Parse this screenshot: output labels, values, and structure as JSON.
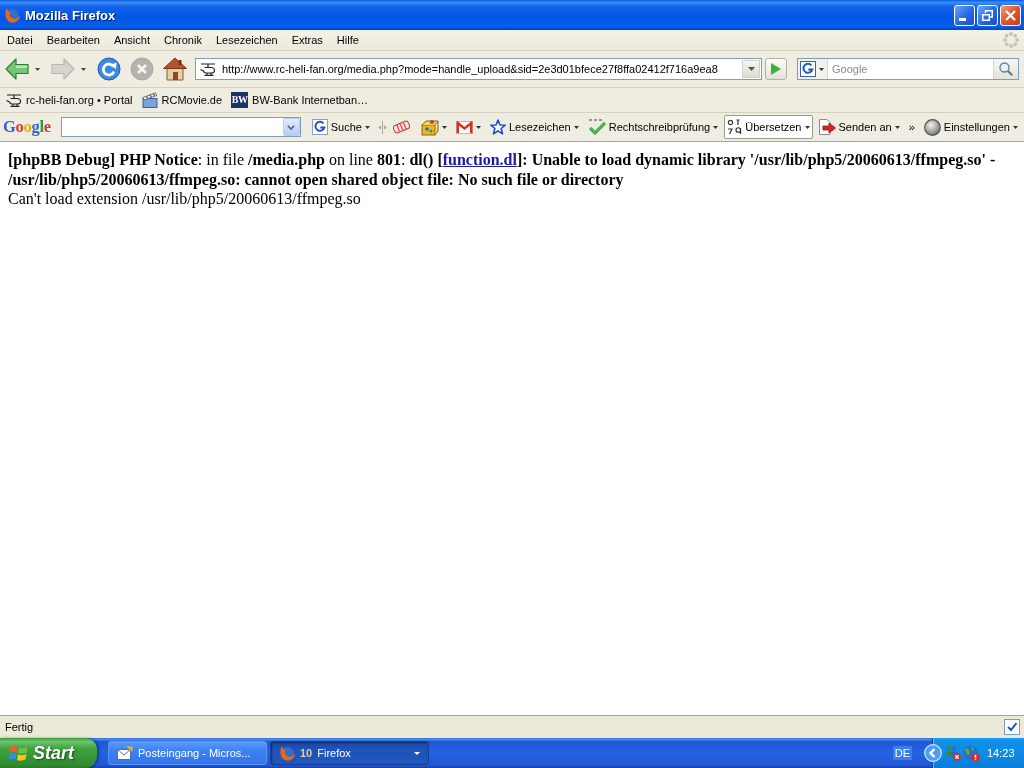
{
  "window": {
    "title": "Mozilla Firefox"
  },
  "menu_bar": [
    "Datei",
    "Bearbeiten",
    "Ansicht",
    "Chronik",
    "Lesezeichen",
    "Extras",
    "Hilfe"
  ],
  "navigation_toolbar": {
    "buttons": [
      {
        "kind": "back",
        "disabled": false,
        "menu": true
      },
      {
        "kind": "forward",
        "disabled": true,
        "menu": true
      },
      {
        "kind": "reload",
        "disabled": false,
        "menu": false
      },
      {
        "kind": "stop",
        "disabled": true,
        "menu": false
      },
      {
        "kind": "home",
        "disabled": false,
        "menu": false
      }
    ],
    "address": "http://www.rc-heli-fan.org/media.php?mode=handle_upload&sid=2e3d01bfece27f8ffa02412f716a9ea8",
    "search": {
      "placeholder": "Google"
    }
  },
  "bookmarks_toolbar": [
    {
      "kind": "helicopter",
      "label": "rc-heli-fan.org • Portal"
    },
    {
      "kind": "clapperboard",
      "label": "RCMovie.de"
    },
    {
      "kind": "logo",
      "logo": "BW",
      "label": "BW-Bank Internetban…"
    }
  ],
  "google_toolbar": {
    "logo": "Google",
    "items": [
      {
        "kind": "search",
        "label": "Suche",
        "menu": true,
        "highlighted": false
      },
      {
        "kind": "bandage",
        "menu": false,
        "highlighted": false
      },
      {
        "kind": "cube",
        "menu": true,
        "highlighted": false
      },
      {
        "kind": "mail",
        "menu": true,
        "highlighted": false
      },
      {
        "kind": "bookmarks",
        "label": "Lesezeichen",
        "menu": true,
        "highlighted": false
      },
      {
        "kind": "spellcheck",
        "label": "Rechtschreibprüfung",
        "menu": true,
        "highlighted": false
      },
      {
        "kind": "translate",
        "label": "Übersetzen",
        "menu": true,
        "highlighted": true
      },
      {
        "kind": "send",
        "label": "Senden an",
        "menu": true,
        "highlighted": false
      },
      {
        "kind": "overflow",
        "label": "»",
        "menu": false,
        "highlighted": false
      },
      {
        "kind": "settings",
        "label": "Einstellungen",
        "menu": true,
        "highlighted": false
      }
    ]
  },
  "page": {
    "notice": {
      "before": "**[phpBB Debug] PHP Notice**: in file **/media.php** on line **801**: **dl() [**",
      "link": "function.dl",
      "after": "**]: Unable to load dynamic library '/usr/lib/php5/20060613/ffmpeg.so' - /usr/lib/php5/20060613/ffmpeg.so: cannot open shared object file: No such file or directory**"
    },
    "message": "Can't load extension /usr/lib/php5/20060613/ffmpeg.so"
  },
  "status_bar": {
    "text": "Fertig"
  },
  "taskbar": {
    "start": "Start",
    "tasks": [
      {
        "kind": "mail",
        "label": "Posteingang - Micros...",
        "selected": false
      },
      {
        "kind": "browser",
        "count": "10",
        "label": "Firefox",
        "selected": true
      }
    ],
    "language": "DE",
    "clock": "14:23"
  }
}
